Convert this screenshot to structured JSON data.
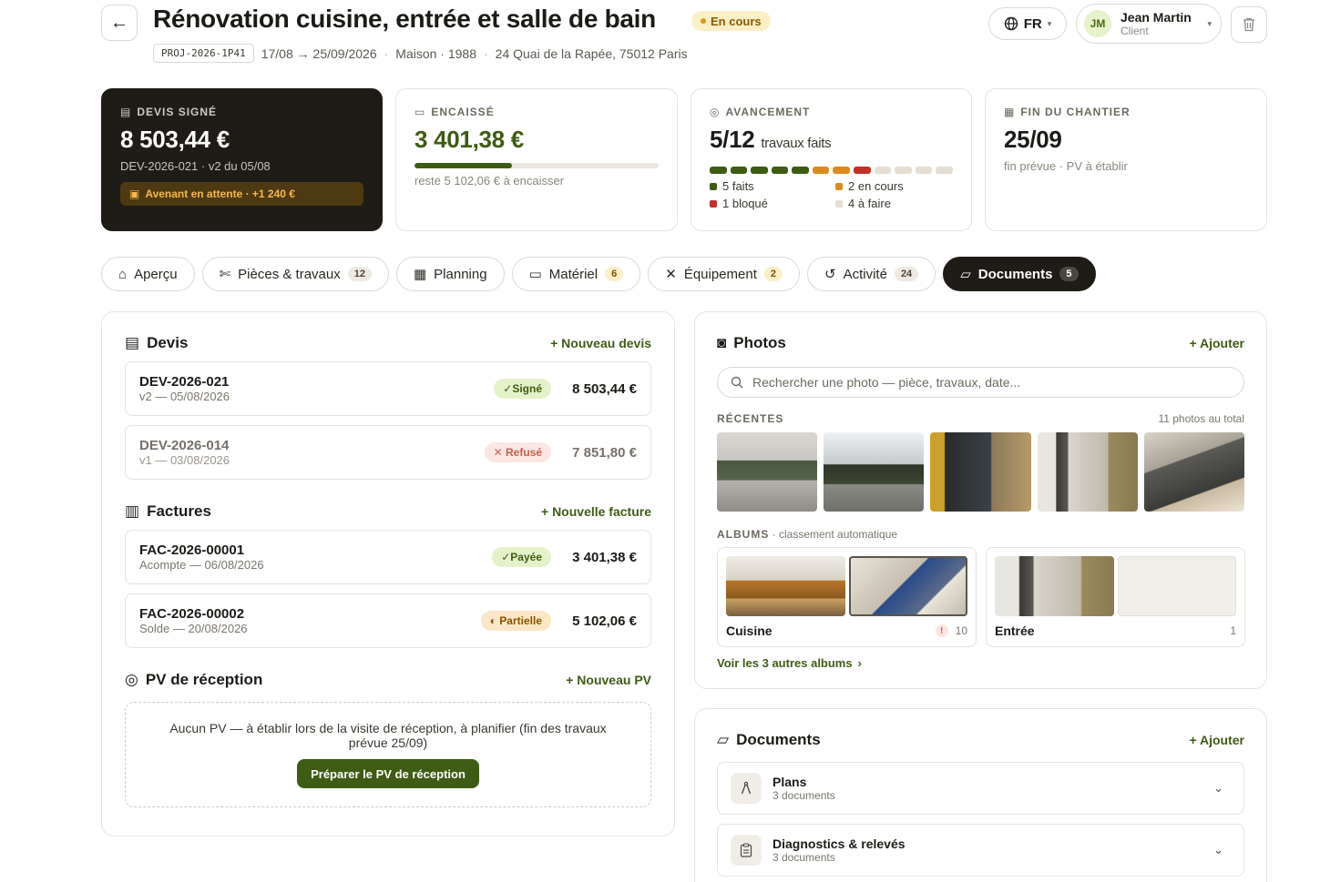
{
  "header": {
    "title": "Rénovation cuisine, entrée et salle de bain",
    "status": "En cours",
    "code": "PROJ-2026-1P41",
    "dates": "17/08 → 25/09/2026",
    "house": "Maison · 1988",
    "address": "24 Quai de la Rapée, 75012 Paris",
    "lang": "FR",
    "user": {
      "initials": "JM",
      "name": "Jean Martin",
      "role": "Client"
    }
  },
  "kpis": {
    "devis": {
      "label": "DEVIS SIGNÉ",
      "value": "8 503,44 €",
      "sub": "DEV-2026-021 · v2 du 05/08",
      "avenant": "Avenant en attente · +1 240 €"
    },
    "encaisse": {
      "label": "ENCAISSÉ",
      "value": "3 401,38 €",
      "sub": "reste 5 102,06 € à encaisser",
      "progress": 0.4
    },
    "avancement": {
      "label": "AVANCEMENT",
      "value": "5/12",
      "unit": "travaux faits",
      "segments": [
        "done",
        "done",
        "done",
        "done",
        "done",
        "progress",
        "progress",
        "blocked",
        "todo",
        "todo",
        "todo",
        "todo"
      ],
      "legend": [
        {
          "text": "5 faits",
          "color": "#3e5c14"
        },
        {
          "text": "2 en cours",
          "color": "#dc8a1e"
        },
        {
          "text": "1 bloqué",
          "color": "#c2302a"
        },
        {
          "text": "4 à faire",
          "color": "#e4dfd2"
        }
      ]
    },
    "fin": {
      "label": "FIN DU CHANTIER",
      "value": "25/09",
      "sub": "fin prévue · PV à établir"
    }
  },
  "tabs": [
    {
      "label": "Aperçu",
      "count": null
    },
    {
      "label": "Pièces & travaux",
      "count": "12"
    },
    {
      "label": "Planning",
      "count": null
    },
    {
      "label": "Matériel",
      "count": "6"
    },
    {
      "label": "Équipement",
      "count": "2"
    },
    {
      "label": "Activité",
      "count": "24"
    },
    {
      "label": "Documents",
      "count": "5"
    }
  ],
  "devis": {
    "title": "Devis",
    "action": "+ Nouveau devis",
    "items": [
      {
        "id": "DEV-2026-021",
        "sub": "v2 — 05/08/2026",
        "badge": "✓Signé",
        "amount": "8 503,44 €"
      },
      {
        "id": "DEV-2026-014",
        "sub": "v1 — 03/08/2026",
        "badge": "✕ Refusé",
        "amount": "7 851,80 €"
      }
    ]
  },
  "factures": {
    "title": "Factures",
    "action": "+ Nouvelle facture",
    "items": [
      {
        "id": "FAC-2026-00001",
        "sub": "Acompte — 06/08/2026",
        "badge": "✓Payée",
        "amount": "3 401,38 €"
      },
      {
        "id": "FAC-2026-00002",
        "sub": "Solde — 20/08/2026",
        "badge": "◐ Partielle",
        "amount": "5 102,06 €"
      }
    ]
  },
  "pv": {
    "title": "PV de réception",
    "action": "+ Nouveau PV",
    "empty": "Aucun PV — à établir lors de la visite de réception, à planifier (fin des travaux prévue 25/09)",
    "button": "Préparer le PV de réception"
  },
  "photos": {
    "title": "Photos",
    "action": "+ Ajouter",
    "search_placeholder": "Rechercher une photo — pièce, travaux, date...",
    "recent_label": "RÉCENTES",
    "total": "11 photos au total",
    "albums_label": "ALBUMS",
    "albums_sub": "· classement automatique",
    "albums": [
      {
        "name": "Cuisine",
        "count": "10"
      },
      {
        "name": "Entrée",
        "count": "1"
      }
    ],
    "more": "Voir les 3 autres albums"
  },
  "documents": {
    "title": "Documents",
    "action": "+ Ajouter",
    "folders": [
      {
        "name": "Plans",
        "count": "3 documents"
      },
      {
        "name": "Diagnostics & relevés",
        "count": "3 documents"
      }
    ]
  }
}
